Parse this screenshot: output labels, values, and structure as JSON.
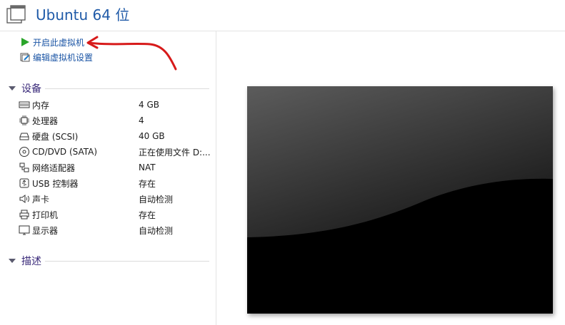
{
  "header": {
    "title": "Ubuntu 64 位",
    "icon": "vm-window-icon"
  },
  "actions": [
    {
      "label": "开启此虚拟机",
      "icon": "play-icon"
    },
    {
      "label": "编辑虚拟机设置",
      "icon": "edit-settings-icon"
    }
  ],
  "sections": {
    "devices": "设备",
    "description": "描述"
  },
  "devices": [
    {
      "name": "内存",
      "value": "4 GB",
      "icon": "memory-icon"
    },
    {
      "name": "处理器",
      "value": "4",
      "icon": "cpu-icon"
    },
    {
      "name": "硬盘 (SCSI)",
      "value": "40 GB",
      "icon": "disk-icon"
    },
    {
      "name": "CD/DVD (SATA)",
      "value": "正在使用文件 D:...",
      "icon": "cd-icon"
    },
    {
      "name": "网络适配器",
      "value": "NAT",
      "icon": "network-icon"
    },
    {
      "name": "USB 控制器",
      "value": "存在",
      "icon": "usb-icon"
    },
    {
      "name": "声卡",
      "value": "自动检测",
      "icon": "speaker-icon"
    },
    {
      "name": "打印机",
      "value": "存在",
      "icon": "printer-icon"
    },
    {
      "name": "显示器",
      "value": "自动检测",
      "icon": "monitor-icon"
    }
  ],
  "colors": {
    "title": "#1f5aa8",
    "link": "#1b55a5",
    "section": "#3a2a7a",
    "play": "#2aa52a",
    "annotation_arrow": "#d71a1a"
  }
}
